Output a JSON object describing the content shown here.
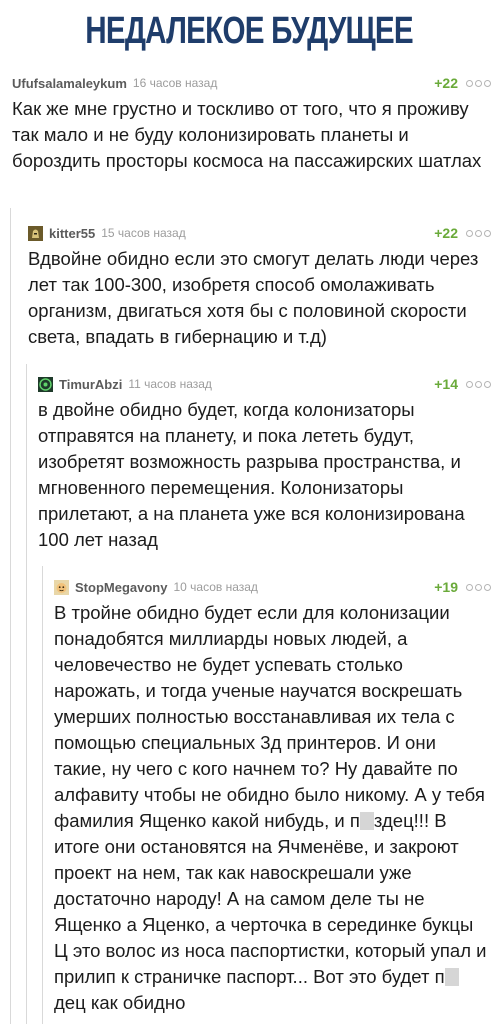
{
  "header": {
    "title": "НЕДАЛЕКОЕ БУДУЩЕЕ"
  },
  "comments": [
    {
      "username": "Ufufsalamaleykum",
      "time": "16 часов назад",
      "rating": "+22",
      "text": "Как же мне грустно и тоскливо от того, что я проживу так мало и не буду колонизировать планеты и бороздить просторы космоса на пассажирских шатлах",
      "avatar": "none"
    },
    {
      "username": "kitter55",
      "time": "15 часов назад",
      "rating": "+22",
      "text": "Вдвойне обидно если это смогут делать люди через лет так 100-300, изобретя способ омолаживать организм, двигаться хотя бы с половиной скорости света, впадать в гибернацию и т.д)",
      "avatar": "knight-avatar-icon"
    },
    {
      "username": "TimurAbzi",
      "time": "11 часов назад",
      "rating": "+14",
      "text": "в двойне обидно будет, когда колонизаторы отправятся на планету, и пока лететь будут, изобретят возможность разрыва пространства, и мгновенного перемещения. Колонизаторы прилетают, а на планета уже вся колонизирована 100 лет назад",
      "avatar": "green-circle-avatar-icon"
    },
    {
      "username": "StopMegavony",
      "time": "10 часов назад",
      "rating": "+19",
      "text_parts": [
        "В тройне обидно будет если для колонизации понадобятся миллиарды новых людей, а человечество не будет успевать столько нарожать, и тогда ученые научатся воскрешать умерших полностью восстанавливая их тела с помощью специальных 3д принтеров. И они такие, ну чего с кого начнем то? Ну давайте по алфавиту чтобы не обидно было никому. А у тебя фамилия Ященко какой нибудь, и п",
        "здец!!! В итоге они остановятся на Ячменёве, и закроют проект на нем, так как навоскрешали уже достаточно народу! А на самом деле ты не Ященко а Яценко, а черточка в серединке букцы Ц это волос из носа паспортистки, который упал и прилип к страничке паспорт... Вот это будет п",
        "дец как обидно"
      ],
      "avatar": "cartoon-face-avatar-icon"
    }
  ],
  "colors": {
    "title": "#1f3d6b",
    "rating": "#6aaa3a",
    "username": "#5b5b5b",
    "timestamp": "#9c9c9c",
    "thread_line": "#d9d9d9"
  }
}
